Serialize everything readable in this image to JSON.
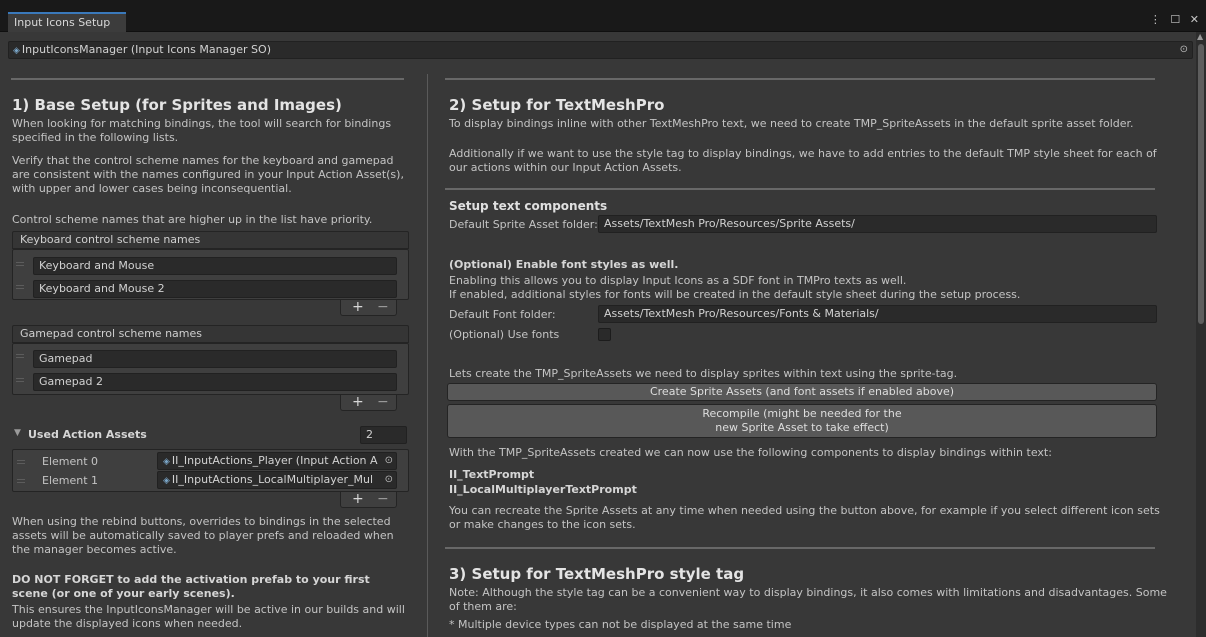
{
  "window": {
    "tab_title": "Input Icons Setup",
    "controls": "⋮ ☐ ✕"
  },
  "object_field": {
    "value": "InputIconsManager (Input Icons Manager SO)"
  },
  "left": {
    "title": "1) Base Setup (for Sprites and Images)",
    "p1": "When looking for matching bindings, the tool will search for bindings specified in the following lists.",
    "p2": "Verify that the control scheme names for the keyboard and gamepad are consistent with the names configured in your Input Action Asset(s), with upper and lower cases being inconsequential.",
    "p3": "Control scheme names that are higher up in the list have priority.",
    "keyboard_list": {
      "header": "Keyboard control scheme names",
      "items": [
        "Keyboard and Mouse",
        "Keyboard and Mouse 2"
      ]
    },
    "gamepad_list": {
      "header": "Gamepad control scheme names",
      "items": [
        "Gamepad",
        "Gamepad 2"
      ]
    },
    "plus": "+",
    "minus": "−",
    "used_assets": {
      "label": "Used Action Assets",
      "arrow": "▼",
      "count": "2",
      "elements": [
        {
          "label": "Element 0",
          "value": "II_InputActions_Player (Input Action A"
        },
        {
          "label": "Element 1",
          "value": "II_InputActions_LocalMultiplayer_Mul"
        }
      ]
    },
    "p4": "When using the rebind buttons, overrides to bindings in the selected assets will be automatically saved to player prefs and reloaded when the manager becomes active.",
    "p5_bold": "DO NOT FORGET to add the activation prefab to your first scene (or one of your early scenes).",
    "p6": "This ensures the InputIconsManager will be active in our builds and will update the displayed icons when needed."
  },
  "right": {
    "title2": "2) Setup for TextMeshPro",
    "t2p1": "To display bindings inline with other TextMeshPro text, we need to create TMP_SpriteAssets in the default sprite asset folder.",
    "t2p2": "Additionally if we want to use the style tag to display bindings, we have to add entries to the default TMP style sheet for each of our actions within our Input Action Assets.",
    "setup_text_components": "Setup text components",
    "sprite_folder_label": "Default Sprite Asset folder:",
    "sprite_folder_value": "Assets/TextMesh Pro/Resources/Sprite Assets/",
    "optional_fonts_title": "(Optional) Enable font styles as well.",
    "optional_fonts_p1": "Enabling this allows you to display Input Icons as a SDF font in TMPro texts as well.",
    "optional_fonts_p2": "If enabled,  additional styles for fonts will be created in the default style sheet during the setup process.",
    "font_folder_label": "Default Font folder:",
    "font_folder_value": "Assets/TextMesh Pro/Resources/Fonts & Materials/",
    "use_fonts_label": "(Optional) Use fonts",
    "create_intro": "Lets create the TMP_SpriteAssets we need to display sprites within text using the sprite-tag.",
    "create_button": "Create Sprite Assets (and font assets if enabled above)",
    "recompile_button_l1": "Recompile (might be needed for the",
    "recompile_button_l2": "new Sprite Asset to take effect)",
    "components_intro": "With the TMP_SpriteAssets created we can now use the following components to display bindings within text:",
    "component1": "II_TextPrompt",
    "component2": "II_LocalMultiplayerTextPrompt",
    "recreate_p": "You can recreate the Sprite Assets at any time when needed using the button above, for example if you select different icon sets or make changes to the icon sets.",
    "title3": "3) Setup for TextMeshPro style tag",
    "t3p1": "Note: Although the style tag can be a convenient way to display bindings, it also comes with limitations and disadvantages. Some of them are:",
    "t3p2": "* Multiple device types can not be displayed at the same time"
  }
}
